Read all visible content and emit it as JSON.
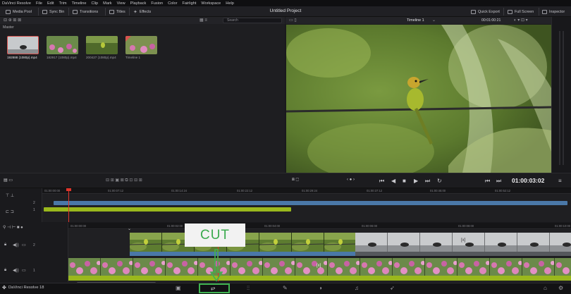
{
  "menu": [
    "DaVinci Resolve",
    "File",
    "Edit",
    "Trim",
    "Timeline",
    "Clip",
    "Mark",
    "View",
    "Playback",
    "Fusion",
    "Color",
    "Fairlight",
    "Workspace",
    "Help"
  ],
  "toolbar": {
    "media_pool": "Media Pool",
    "sync_bin": "Sync Bin",
    "transitions": "Transitions",
    "titles": "Titles",
    "effects": "Effects",
    "project_title": "Untitled Project",
    "quick_export": "Quick Export",
    "full_screen": "Full Screen",
    "inspector": "Inspector"
  },
  "media_pool": {
    "bin_label": "Master",
    "search_placeholder": "Search",
    "clips": [
      {
        "name": "192888 (1080p).mp4",
        "selected": true
      },
      {
        "name": "182917 (1080p).mp4",
        "selected": false
      },
      {
        "name": "200427 (1080p).mp4",
        "selected": false
      },
      {
        "name": "Timeline 1",
        "selected": false
      }
    ]
  },
  "viewer": {
    "timeline_name": "Timeline 1",
    "source_timecode": "00:01:00:21",
    "timecode": "01:00:03:02"
  },
  "upper_ruler": [
    "01:00:00:00",
    "01:00:07:12",
    "01:00:14:24",
    "01:00:22:12",
    "01:00:29:24",
    "01:00:37:12",
    "01:00:45:00",
    "01:00:52:12"
  ],
  "lower_ruler": [
    "01:00:00:00",
    "01:00:02:00",
    "01:00:04:00",
    "01:00:06:00",
    "01:00:08:00",
    "01:00:10:00"
  ],
  "tracks": {
    "v2": "2",
    "v1": "1",
    "upper_v2": "2",
    "upper_v1": "1"
  },
  "clip_badges": {
    "v2_end": "[x]",
    "v1_mid": "[x]"
  },
  "overlay_label": "CUT",
  "app_name": "DaVinci Resolve 18",
  "colors": {
    "accent_green": "#3fb350",
    "playhead": "#e0352b",
    "v2_bar": "#4a78a8",
    "audio_bar": "#9ab81c"
  }
}
